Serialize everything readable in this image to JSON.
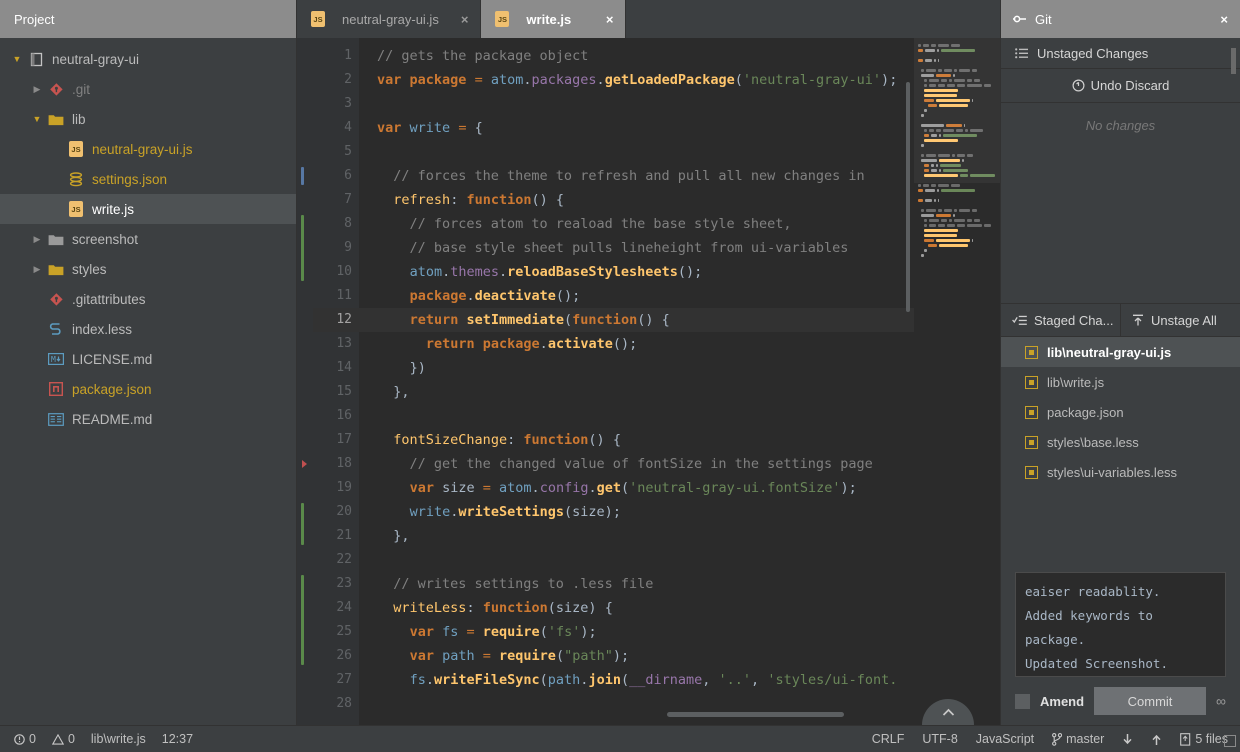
{
  "sidebar": {
    "title": "Project",
    "tree": [
      {
        "label": "neutral-gray-ui",
        "icon": "module-icon",
        "arrow": "down",
        "indent": 0,
        "selected": false,
        "color": "normal"
      },
      {
        "label": ".git",
        "icon": "git-icon",
        "arrow": "right",
        "indent": 1,
        "selected": false,
        "color": "dim"
      },
      {
        "label": "lib",
        "icon": "folder-icon",
        "arrow": "down",
        "indent": 1,
        "selected": false,
        "color": "normal"
      },
      {
        "label": "neutral-gray-ui.js",
        "icon": "js-icon",
        "arrow": "none",
        "indent": 2,
        "selected": false,
        "color": "yellow"
      },
      {
        "label": "settings.json",
        "icon": "json-icon",
        "arrow": "none",
        "indent": 2,
        "selected": false,
        "color": "yellow"
      },
      {
        "label": "write.js",
        "icon": "js-icon",
        "arrow": "none",
        "indent": 2,
        "selected": true,
        "color": "white"
      },
      {
        "label": "screenshot",
        "icon": "folder-gray-icon",
        "arrow": "right",
        "indent": 1,
        "selected": false,
        "color": "normal"
      },
      {
        "label": "styles",
        "icon": "folder-icon",
        "arrow": "right",
        "indent": 1,
        "selected": false,
        "color": "normal"
      },
      {
        "label": ".gitattributes",
        "icon": "git-icon",
        "arrow": "none",
        "indent": 1,
        "selected": false,
        "color": "normal"
      },
      {
        "label": "index.less",
        "icon": "less-icon",
        "arrow": "none",
        "indent": 1,
        "selected": false,
        "color": "normal"
      },
      {
        "label": "LICENSE.md",
        "icon": "markdown-icon",
        "arrow": "none",
        "indent": 1,
        "selected": false,
        "color": "normal"
      },
      {
        "label": "package.json",
        "icon": "npm-icon",
        "arrow": "none",
        "indent": 1,
        "selected": false,
        "color": "yellow"
      },
      {
        "label": "README.md",
        "icon": "readme-icon",
        "arrow": "none",
        "indent": 1,
        "selected": false,
        "color": "normal"
      }
    ]
  },
  "tabs": [
    {
      "label": "neutral-gray-ui.js",
      "icon": "js-icon",
      "active": false,
      "close": "×"
    },
    {
      "label": "write.js",
      "icon": "js-icon",
      "active": true,
      "close": "×"
    }
  ],
  "editor": {
    "current_line": 12,
    "first_line": 1,
    "lines": [
      {
        "n": 1,
        "text": "// gets the package object"
      },
      {
        "n": 2,
        "text": "var package = atom.packages.getLoadedPackage('neutral-gray-ui');"
      },
      {
        "n": 3,
        "text": ""
      },
      {
        "n": 4,
        "text": "var write = {"
      },
      {
        "n": 5,
        "text": ""
      },
      {
        "n": 6,
        "text": "  // forces the theme to refresh and pull all new changes in"
      },
      {
        "n": 7,
        "text": "  refresh: function() {"
      },
      {
        "n": 8,
        "text": "    // forces atom to reaload the base style sheet,"
      },
      {
        "n": 9,
        "text": "    // base style sheet pulls lineheight from ui-variables"
      },
      {
        "n": 10,
        "text": "    atom.themes.reloadBaseStylesheets();"
      },
      {
        "n": 11,
        "text": "    package.deactivate();"
      },
      {
        "n": 12,
        "text": "    return setImmediate(function() {"
      },
      {
        "n": 13,
        "text": "      return package.activate();"
      },
      {
        "n": 14,
        "text": "    })"
      },
      {
        "n": 15,
        "text": "  },"
      },
      {
        "n": 16,
        "text": ""
      },
      {
        "n": 17,
        "text": "  fontSizeChange: function() {"
      },
      {
        "n": 18,
        "text": "    // get the changed value of fontSize in the settings page"
      },
      {
        "n": 19,
        "text": "    var size = atom.config.get('neutral-gray-ui.fontSize');"
      },
      {
        "n": 20,
        "text": "    write.writeSettings(size);"
      },
      {
        "n": 21,
        "text": "  },"
      },
      {
        "n": 22,
        "text": ""
      },
      {
        "n": 23,
        "text": "  // writes settings to .less file"
      },
      {
        "n": 24,
        "text": "  writeLess: function(size) {"
      },
      {
        "n": 25,
        "text": "    var fs = require('fs');"
      },
      {
        "n": 26,
        "text": "    var path = require(\"path\");"
      },
      {
        "n": 27,
        "text": "    fs.writeFileSync(path.join(__dirname, '..', 'styles/ui-font."
      },
      {
        "n": 28,
        "text": ""
      }
    ]
  },
  "git": {
    "title": "Git",
    "close": "×",
    "unstaged_label": "Unstaged Changes",
    "undo_discard_label": "Undo Discard",
    "no_changes_label": "No changes",
    "staged_label": "Staged Cha...",
    "unstage_all_label": "Unstage All",
    "staged_files": [
      {
        "name": "lib\\neutral-gray-ui.js",
        "selected": true
      },
      {
        "name": "lib\\write.js",
        "selected": false
      },
      {
        "name": "package.json",
        "selected": false
      },
      {
        "name": "styles\\base.less",
        "selected": false
      },
      {
        "name": "styles\\ui-variables.less",
        "selected": false
      }
    ],
    "commit_message": "eaiser readablity.\nAdded keywords to\npackage.\nUpdated Screenshot.",
    "amend_label": "Amend",
    "commit_label": "Commit",
    "infinity_label": "∞"
  },
  "statusbar": {
    "errors": "0",
    "warnings": "0",
    "file": "lib\\write.js",
    "cursor": "12:37",
    "line_ending": "CRLF",
    "encoding": "UTF-8",
    "language": "JavaScript",
    "branch": "master",
    "files_changed": "5 files"
  },
  "colors": {
    "panel_bg": "#3c3f41",
    "editor_bg": "#2b2b2b",
    "header_bg": "#8c8c8c",
    "selection": "#4e5254",
    "accent_yellow": "#c9a227",
    "keyword": "#cc7832",
    "string": "#6a8759",
    "comment": "#808080",
    "function": "#ffc66d",
    "property": "#9876aa"
  }
}
